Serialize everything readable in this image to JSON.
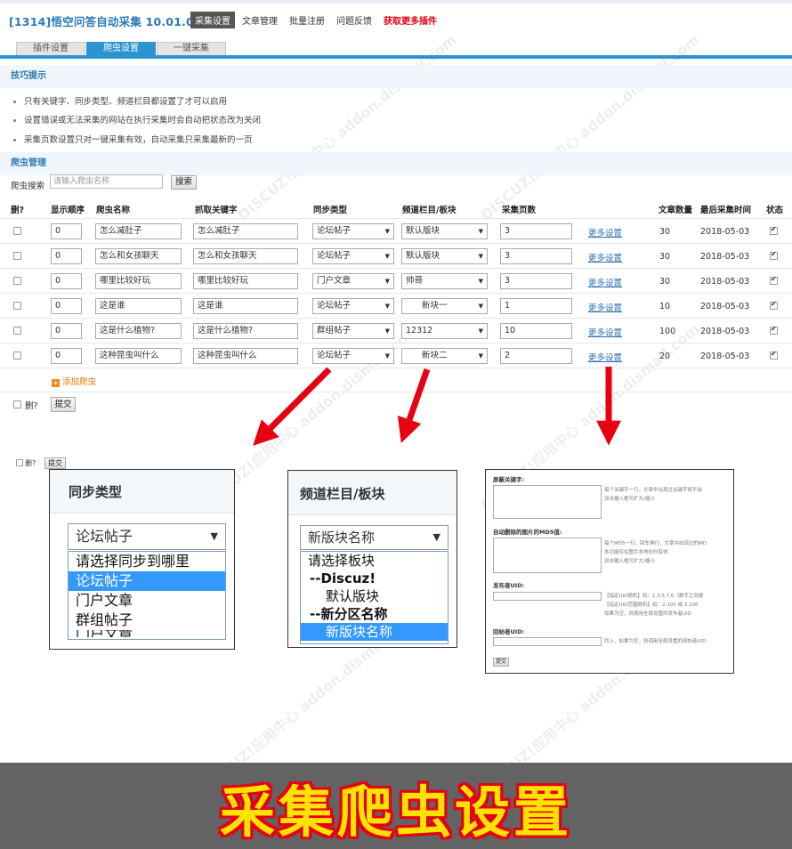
{
  "app": {
    "title": "[1314]悟空问答自动采集 10.01.01",
    "nav": [
      "采集设置",
      "文章管理",
      "批量注册",
      "问题反馈",
      "获取更多插件"
    ]
  },
  "tabs": [
    "插件设置",
    "爬虫设置",
    "一键采集"
  ],
  "tips": {
    "heading": "技巧提示",
    "items": [
      "只有关键字、同步类型、频道栏目都设置了才可以启用",
      "设置错误或无法采集的网站在执行采集时会自动把状态改为关闭",
      "采集页数设置只对一键采集有效，自动采集只采集最新的一页"
    ]
  },
  "crawler": {
    "heading": "爬虫管理",
    "search_label": "爬虫搜索",
    "search_placeholder": "请输入爬虫名称",
    "search_button": "搜索",
    "columns": [
      "删?",
      "显示顺序",
      "爬虫名称",
      "抓取关键字",
      "同步类型",
      "频道栏目/板块",
      "采集页数",
      "文章数量",
      "最后采集时间",
      "状态"
    ],
    "rows": [
      {
        "order": "0",
        "name": "怎么减肚子",
        "keyword": "怎么减肚子",
        "sync": "论坛帖子",
        "channel": "默认版块",
        "pages": "3",
        "more": "更多设置",
        "count": "30",
        "last": "2018-05-03"
      },
      {
        "order": "0",
        "name": "怎么和女孩聊天",
        "keyword": "怎么和女孩聊天",
        "sync": "论坛帖子",
        "channel": "默认版块",
        "pages": "3",
        "more": "更多设置",
        "count": "30",
        "last": "2018-05-03"
      },
      {
        "order": "0",
        "name": "哪里比较好玩",
        "keyword": "哪里比较好玩",
        "sync": "门户文章",
        "channel": "帅哥",
        "pages": "3",
        "more": "更多设置",
        "count": "30",
        "last": "2018-05-03"
      },
      {
        "order": "0",
        "name": "这是谁",
        "keyword": "这是谁",
        "sync": "论坛帖子",
        "channel": "新块一",
        "pages": "1",
        "more": "更多设置",
        "count": "10",
        "last": "2018-05-03"
      },
      {
        "order": "0",
        "name": "这是什么植物?",
        "keyword": "这是什么植物?",
        "sync": "群组帖子",
        "channel": "12312",
        "pages": "10",
        "more": "更多设置",
        "count": "100",
        "last": "2018-05-03"
      },
      {
        "order": "0",
        "name": "这种昆虫叫什么",
        "keyword": "这种昆虫叫什么",
        "sync": "论坛帖子",
        "channel": "新块二",
        "pages": "2",
        "more": "更多设置",
        "count": "20",
        "last": "2018-05-03"
      }
    ],
    "add_label": "添加爬虫",
    "delete_label": "删?",
    "submit_label": "提交"
  },
  "lower_form": {
    "delete_label": "删?",
    "submit_label": "提交"
  },
  "popup_sync": {
    "title": "同步类型",
    "selected": "论坛帖子",
    "options": [
      "请选择同步到哪里",
      "论坛帖子",
      "门户文章",
      "群组帖子"
    ],
    "highlighted_index": 1,
    "cut_text": "门户文章"
  },
  "popup_channel": {
    "title": "频道栏目/板块",
    "selected": "新版块名称",
    "options": [
      "请选择板块",
      "--Discuz!",
      "默认版块",
      "--新分区名称",
      "新版块名称"
    ],
    "bold_indices": [
      1,
      3
    ],
    "highlighted_index": 4
  },
  "popup_more": {
    "fields": [
      "屏蔽关键字:",
      "自动删除的图片的MD5值:",
      "发布者UID:",
      "回帖者UID:"
    ],
    "notes": [
      "每个关键字一行，文章中出现过关键字将不会",
      "双击输入框可扩大/缩小",
      "每个MD5一行，回车换行，文章中出现过的MD",
      "本功能仅在图片本地化时有效",
      "双击输入框可扩大/缩小",
      "【指定UID随机】如：2,3,5,7,6（数字之间使",
      "【指定UID范围随机】如：2-100 或 2,100",
      "如果为空，则调用全局设置的发布者UID",
      "同上，如果为空，则调用全局设置的回帖者UID"
    ],
    "submit_label": "提交"
  },
  "banner": "采集爬虫设置",
  "colors": {
    "accent": "#2c95d1",
    "arrow": "#e60012",
    "banner_text": "#ffe200",
    "banner_bg": "#636363"
  }
}
